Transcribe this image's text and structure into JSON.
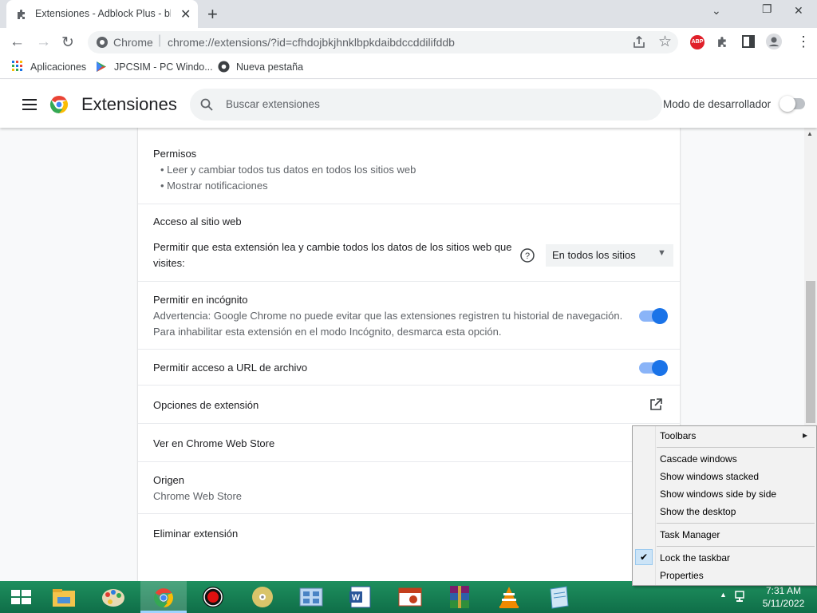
{
  "tab": {
    "title": "Extensiones - Adblock Plus - blo",
    "close": "✕"
  },
  "new_tab": "+",
  "window_controls": {
    "minimize": "⌄",
    "restore": "❐",
    "close": "✕"
  },
  "toolbar": {
    "back": "←",
    "forward": "→",
    "reload": "↻"
  },
  "omnibox": {
    "site": "Chrome",
    "separator": "|",
    "url": "chrome://extensions/?id=cfhdojbkjhnklbpkdaibdccddilifddb"
  },
  "toolbar_icons": {
    "share": "share-icon",
    "star": "☆",
    "abp": "ABP",
    "puzzle": "puzzle-icon",
    "sidepanel": "side-panel-icon",
    "profile": "profile-icon",
    "menu": "⋮"
  },
  "bookmarks": [
    {
      "label": "Aplicaciones",
      "icon": "apps-grid-icon"
    },
    {
      "label": "JPCSIM - PC Windo...",
      "icon": "play-store-icon"
    },
    {
      "label": "Nueva pestaña",
      "icon": "chrome-icon"
    }
  ],
  "header": {
    "title": "Extensiones",
    "search_placeholder": "Buscar extensiones",
    "dev_mode_label": "Modo de desarrollador",
    "dev_mode_on": false
  },
  "details": {
    "permissions_title": "Permisos",
    "permissions": [
      "Leer y cambiar todos tus datos en todos los sitios web",
      "Mostrar notificaciones"
    ],
    "site_access_title": "Acceso al sitio web",
    "site_access_desc_1": "Permitir que esta extensión lea y cambie todos los datos de los sitios web que",
    "site_access_desc_2": "visites:",
    "site_access_value": "En todos los sitios",
    "incognito_title": "Permitir en incógnito",
    "incognito_warning_1": "Advertencia: Google Chrome no puede evitar que las extensiones registren tu historial de navegación.",
    "incognito_warning_2": "Para inhabilitar esta extensión en el modo Incógnito, desmarca esta opción.",
    "incognito_on": true,
    "file_access_title": "Permitir acceso a URL de archivo",
    "file_access_on": true,
    "options_title": "Opciones de extensión",
    "webstore_title": "Ver en Chrome Web Store",
    "origin_title": "Origen",
    "origin_value": "Chrome Web Store",
    "remove_title": "Eliminar extensión"
  },
  "context_menu": {
    "items": [
      "Toolbars",
      "Cascade windows",
      "Show windows stacked",
      "Show windows side by side",
      "Show the desktop",
      "Task Manager",
      "Lock the taskbar",
      "Properties"
    ],
    "submenu_arrow": "▸",
    "check": "✔"
  },
  "taskbar": {
    "apps": [
      "windows-start-icon",
      "file-explorer-icon",
      "paint-icon",
      "chrome-icon",
      "record-icon",
      "disc-icon",
      "control-panel-icon",
      "word-icon",
      "presentation-icon",
      "winrar-icon",
      "vlc-icon",
      "notepad-icon"
    ],
    "time": "7:31 AM",
    "date": "5/11/2022"
  },
  "colors": {
    "accent": "#1a73e8",
    "taskbar": "#158a5a"
  }
}
